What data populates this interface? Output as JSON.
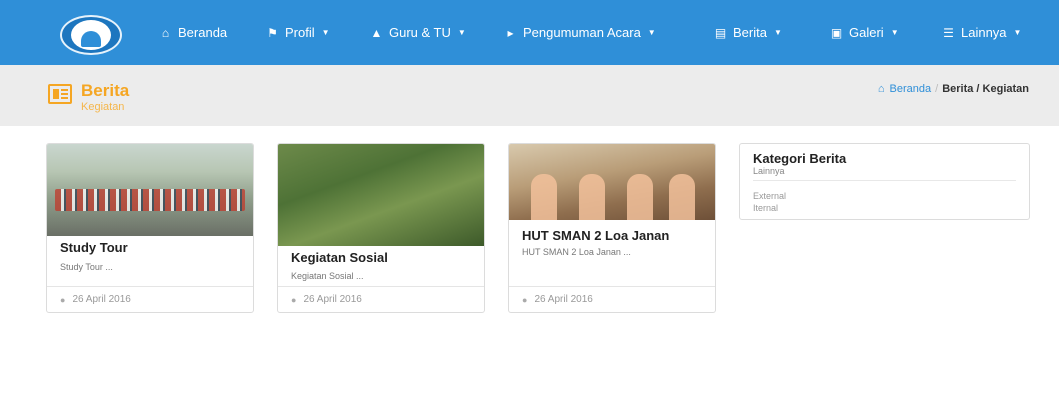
{
  "navbar": {
    "items": [
      {
        "label": "Beranda",
        "icon": "home-icon",
        "dropdown": false
      },
      {
        "label": "Profil",
        "icon": "flag-icon",
        "dropdown": true
      },
      {
        "label": "Guru & TU",
        "icon": "graduation-cap-icon",
        "dropdown": true
      },
      {
        "label": "Pengumuman Acara",
        "icon": "bullhorn-icon",
        "dropdown": true
      },
      {
        "label": "Berita",
        "icon": "newspaper-icon",
        "dropdown": true
      },
      {
        "label": "Galeri",
        "icon": "image-icon",
        "dropdown": true
      },
      {
        "label": "Lainnya",
        "icon": "list-icon",
        "dropdown": true
      }
    ]
  },
  "banner": {
    "title": "Berita",
    "subtitle": "Kegiatan",
    "icon": "newspaper-icon",
    "breadcrumb": {
      "home": "Beranda",
      "separator": "/",
      "current": "Berita / Kegiatan"
    }
  },
  "cards": [
    {
      "title": "Study Tour",
      "excerpt": "Study Tour ...",
      "date": "26 April 2016"
    },
    {
      "title": "Kegiatan Sosial",
      "excerpt": "Kegiatan Sosial ...",
      "date": "26 April 2016"
    },
    {
      "title": "HUT SMAN 2 Loa Janan",
      "excerpt": "HUT SMAN 2 Loa Janan ...",
      "date": "26 April 2016"
    }
  ],
  "sidebar": {
    "title": "Kategori Berita",
    "subtitle": "Lainnya",
    "links": [
      "External",
      "Iternal"
    ]
  },
  "colors": {
    "navbar": "#2f8fd8",
    "accent": "#f5a623",
    "banner_bg": "#ececec"
  }
}
